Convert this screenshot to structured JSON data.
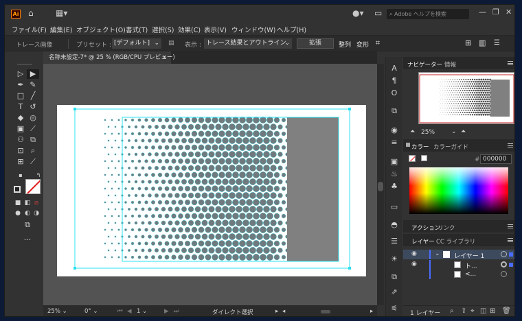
{
  "app": {
    "logo": "Ai",
    "search_placeholder": "Adobe ヘルプを検索"
  },
  "menus": [
    "ファイル(F)",
    "編集(E)",
    "オブジェクト(O)",
    "書式(T)",
    "選択(S)",
    "効果(C)",
    "表示(V)",
    "ウィンドウ(W)",
    "ヘルプ(H)"
  ],
  "control_bar": {
    "object_label": "トレース画像",
    "preset_label": "プリセット :",
    "preset_value": "[デフォルト]",
    "view_label": "表示 :",
    "view_value": "トレース結果とアウトライン",
    "expand_button": "拡張",
    "align_label": "整列",
    "transform_label": "変形"
  },
  "document_tab": {
    "title": "名称未設定-7* @ 25 % (RGB/CPU プレビュー)",
    "close": "×"
  },
  "status_bar": {
    "zoom": "25%",
    "rotation": "0°",
    "artboard_number": "1",
    "tool_name": "ダイレクト選択"
  },
  "navigator": {
    "tabs": [
      "ナビゲーター",
      "情報"
    ],
    "zoom": "25%"
  },
  "color_panel": {
    "tabs": [
      "カラー",
      "カラーガイド"
    ],
    "hex_symbol": "#",
    "hex_value": "000000"
  },
  "action_panel": {
    "tabs": [
      "アクション",
      "リンク"
    ]
  },
  "layers_panel": {
    "tabs": [
      "レイヤー",
      "CC ライブラリ"
    ],
    "layers": [
      {
        "name": "レイヤー 1",
        "indent": 0
      },
      {
        "name": "ト...",
        "indent": 1
      },
      {
        "name": "<...",
        "indent": 1
      }
    ],
    "footer_count": "1 レイヤー"
  },
  "colors": {
    "accent_layer": "#4a6bff",
    "selection_cyan": "#29e0f0",
    "halftone_dot": "#6f7a7e"
  }
}
